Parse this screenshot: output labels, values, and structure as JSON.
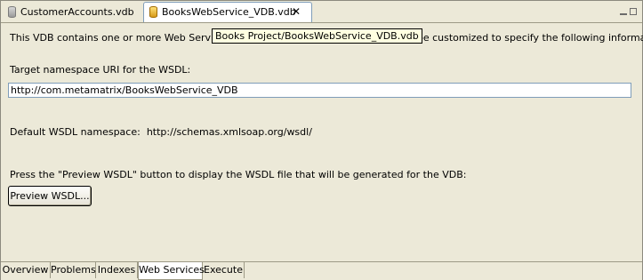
{
  "tabs": [
    {
      "label": "CustomerAccounts.vdb",
      "active": false
    },
    {
      "label": "BooksWebService_VDB.vdb",
      "active": true
    }
  ],
  "tooltip": "Books Project/BooksWebService_VDB.vdb",
  "content": {
    "intro_before": "This VDB contains one or more Web Service mod",
    "intro_after": "be customized to specify the following information:",
    "namespace_label": "Target namespace URI for the WSDL:",
    "namespace_value": "http://com.metamatrix/BooksWebService_VDB",
    "default_ns_label": "Default WSDL namespace:",
    "default_ns_value": "http://schemas.xmlsoap.org/wsdl/",
    "preview_hint": "Press the \"Preview WSDL\" button to display the WSDL file that will be generated for the VDB:",
    "preview_button": "Preview WSDL..."
  },
  "page_tabs": [
    {
      "label": "Overview"
    },
    {
      "label": "Problems"
    },
    {
      "label": "Indexes"
    },
    {
      "label": "Web Services",
      "selected": true
    },
    {
      "label": "Execute"
    }
  ],
  "icons": {
    "close": "close-icon",
    "vdb": "vdb-file-icon"
  }
}
